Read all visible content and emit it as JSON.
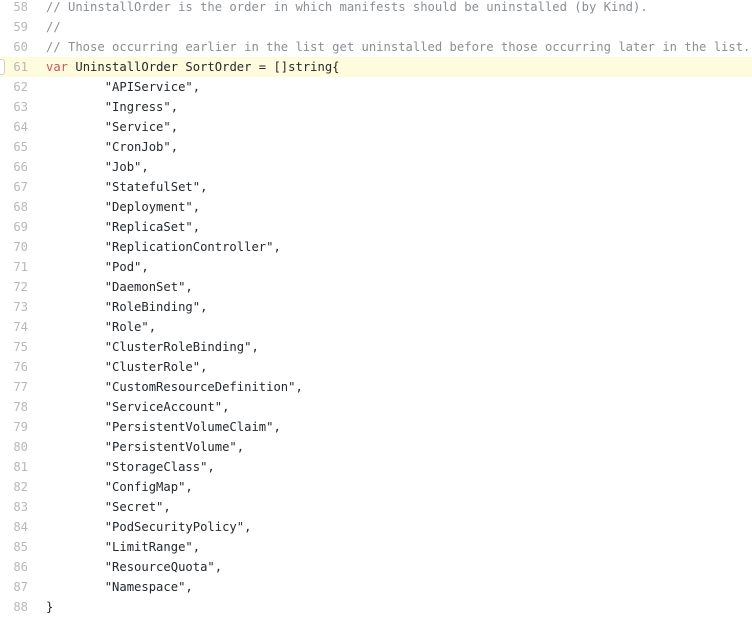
{
  "editor": {
    "name": "code-viewer",
    "language": "go",
    "first_line": 58,
    "last_line": 88,
    "highlighted_line": 61,
    "colors": {
      "background": "#ffffff",
      "highlight_background": "#fffbdd",
      "line_number": "#b6b8ba",
      "text": "#24292e",
      "comment": "#8a8f94",
      "keyword": "#c15b5b"
    },
    "marker": {
      "label": "",
      "icon": "line-anchor-marker"
    }
  },
  "lines": [
    {
      "number": "58",
      "highlighted": false,
      "tokens": [
        {
          "kind": "comment",
          "text": "// UninstallOrder is the order in which manifests should be uninstalled (by Kind)."
        }
      ]
    },
    {
      "number": "59",
      "highlighted": false,
      "tokens": [
        {
          "kind": "comment",
          "text": "//"
        }
      ]
    },
    {
      "number": "60",
      "highlighted": false,
      "tokens": [
        {
          "kind": "comment",
          "text": "// Those occurring earlier in the list get uninstalled before those occurring later in the list."
        }
      ]
    },
    {
      "number": "61",
      "highlighted": true,
      "tokens": [
        {
          "kind": "keyword",
          "text": "var"
        },
        {
          "kind": "plain",
          "text": " UninstallOrder SortOrder = []string{"
        }
      ]
    },
    {
      "number": "62",
      "highlighted": false,
      "tokens": [
        {
          "kind": "string",
          "text": "        \"APIService\","
        }
      ]
    },
    {
      "number": "63",
      "highlighted": false,
      "tokens": [
        {
          "kind": "string",
          "text": "        \"Ingress\","
        }
      ]
    },
    {
      "number": "64",
      "highlighted": false,
      "tokens": [
        {
          "kind": "string",
          "text": "        \"Service\","
        }
      ]
    },
    {
      "number": "65",
      "highlighted": false,
      "tokens": [
        {
          "kind": "string",
          "text": "        \"CronJob\","
        }
      ]
    },
    {
      "number": "66",
      "highlighted": false,
      "tokens": [
        {
          "kind": "string",
          "text": "        \"Job\","
        }
      ]
    },
    {
      "number": "67",
      "highlighted": false,
      "tokens": [
        {
          "kind": "string",
          "text": "        \"StatefulSet\","
        }
      ]
    },
    {
      "number": "68",
      "highlighted": false,
      "tokens": [
        {
          "kind": "string",
          "text": "        \"Deployment\","
        }
      ]
    },
    {
      "number": "69",
      "highlighted": false,
      "tokens": [
        {
          "kind": "string",
          "text": "        \"ReplicaSet\","
        }
      ]
    },
    {
      "number": "70",
      "highlighted": false,
      "tokens": [
        {
          "kind": "string",
          "text": "        \"ReplicationController\","
        }
      ]
    },
    {
      "number": "71",
      "highlighted": false,
      "tokens": [
        {
          "kind": "string",
          "text": "        \"Pod\","
        }
      ]
    },
    {
      "number": "72",
      "highlighted": false,
      "tokens": [
        {
          "kind": "string",
          "text": "        \"DaemonSet\","
        }
      ]
    },
    {
      "number": "73",
      "highlighted": false,
      "tokens": [
        {
          "kind": "string",
          "text": "        \"RoleBinding\","
        }
      ]
    },
    {
      "number": "74",
      "highlighted": false,
      "tokens": [
        {
          "kind": "string",
          "text": "        \"Role\","
        }
      ]
    },
    {
      "number": "75",
      "highlighted": false,
      "tokens": [
        {
          "kind": "string",
          "text": "        \"ClusterRoleBinding\","
        }
      ]
    },
    {
      "number": "76",
      "highlighted": false,
      "tokens": [
        {
          "kind": "string",
          "text": "        \"ClusterRole\","
        }
      ]
    },
    {
      "number": "77",
      "highlighted": false,
      "tokens": [
        {
          "kind": "string",
          "text": "        \"CustomResourceDefinition\","
        }
      ]
    },
    {
      "number": "78",
      "highlighted": false,
      "tokens": [
        {
          "kind": "string",
          "text": "        \"ServiceAccount\","
        }
      ]
    },
    {
      "number": "79",
      "highlighted": false,
      "tokens": [
        {
          "kind": "string",
          "text": "        \"PersistentVolumeClaim\","
        }
      ]
    },
    {
      "number": "80",
      "highlighted": false,
      "tokens": [
        {
          "kind": "string",
          "text": "        \"PersistentVolume\","
        }
      ]
    },
    {
      "number": "81",
      "highlighted": false,
      "tokens": [
        {
          "kind": "string",
          "text": "        \"StorageClass\","
        }
      ]
    },
    {
      "number": "82",
      "highlighted": false,
      "tokens": [
        {
          "kind": "string",
          "text": "        \"ConfigMap\","
        }
      ]
    },
    {
      "number": "83",
      "highlighted": false,
      "tokens": [
        {
          "kind": "string",
          "text": "        \"Secret\","
        }
      ]
    },
    {
      "number": "84",
      "highlighted": false,
      "tokens": [
        {
          "kind": "string",
          "text": "        \"PodSecurityPolicy\","
        }
      ]
    },
    {
      "number": "85",
      "highlighted": false,
      "tokens": [
        {
          "kind": "string",
          "text": "        \"LimitRange\","
        }
      ]
    },
    {
      "number": "86",
      "highlighted": false,
      "tokens": [
        {
          "kind": "string",
          "text": "        \"ResourceQuota\","
        }
      ]
    },
    {
      "number": "87",
      "highlighted": false,
      "tokens": [
        {
          "kind": "string",
          "text": "        \"Namespace\","
        }
      ]
    },
    {
      "number": "88",
      "highlighted": false,
      "tokens": [
        {
          "kind": "plain",
          "text": "}"
        }
      ]
    }
  ]
}
